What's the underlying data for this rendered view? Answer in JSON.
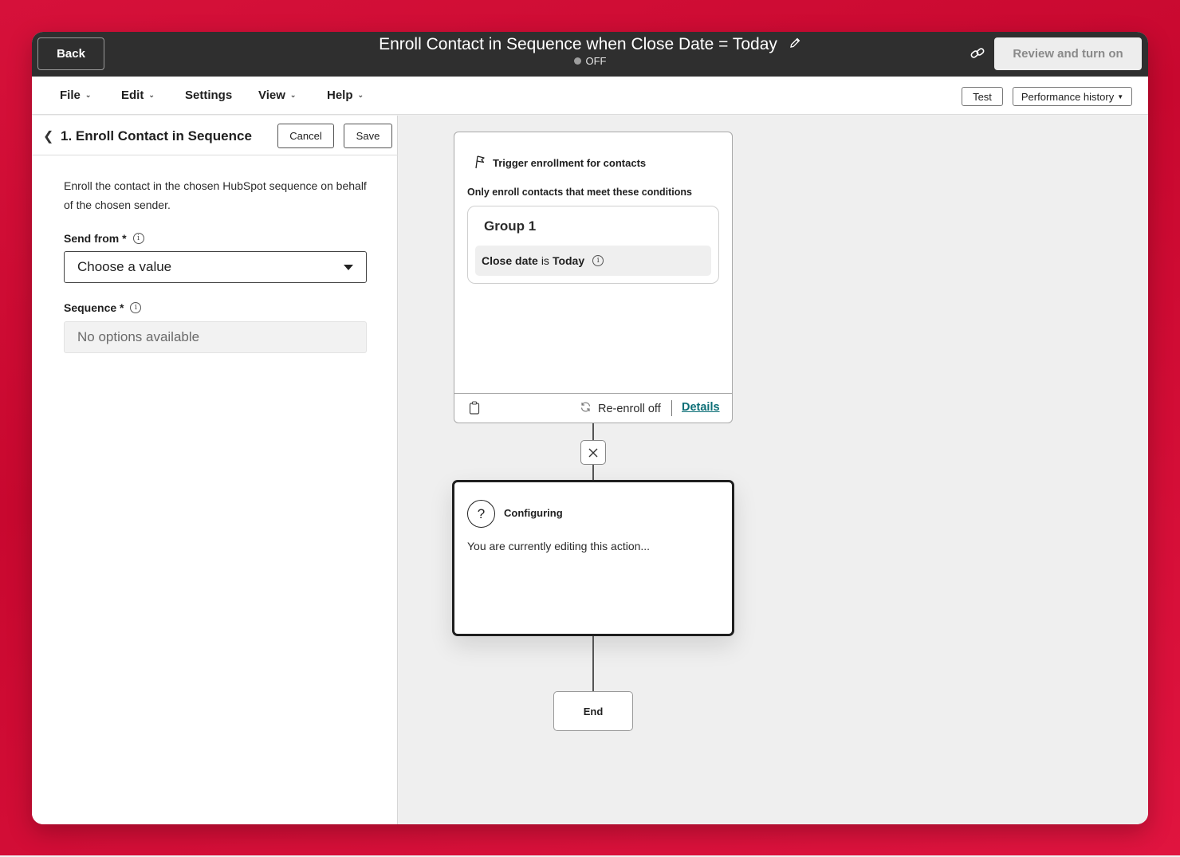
{
  "topbar": {
    "back_label": "Back",
    "workflow_title": "Enroll Contact in Sequence when Close Date = Today",
    "status": "OFF",
    "review_label": "Review and turn on"
  },
  "menubar": {
    "items": [
      {
        "label": "File"
      },
      {
        "label": "Edit"
      },
      {
        "label": "Settings"
      },
      {
        "label": "View"
      },
      {
        "label": "Help"
      }
    ],
    "test_label": "Test",
    "performance_label": "Performance history"
  },
  "panel": {
    "title": "1. Enroll Contact in Sequence",
    "cancel_label": "Cancel",
    "save_label": "Save",
    "description": "Enroll the contact in the chosen HubSpot sequence on behalf of the chosen sender.",
    "send_from_label": "Send from *",
    "send_from_value": "Choose a value",
    "sequence_label": "Sequence *",
    "sequence_value": "No options available"
  },
  "trigger": {
    "header": "Trigger enrollment for contacts",
    "subheader": "Only enroll contacts that meet these conditions",
    "group_title": "Group 1",
    "condition": {
      "property": "Close date",
      "operator": "is",
      "value": "Today"
    },
    "reenroll": "Re-enroll off",
    "details_label": "Details"
  },
  "config": {
    "title": "Configuring",
    "text": "You are currently editing this action..."
  },
  "end_label": "End",
  "colors": {
    "background": "#d6113a",
    "topbar": "#2f2f2f",
    "link": "#0b6e76",
    "canvas": "#efefef"
  }
}
